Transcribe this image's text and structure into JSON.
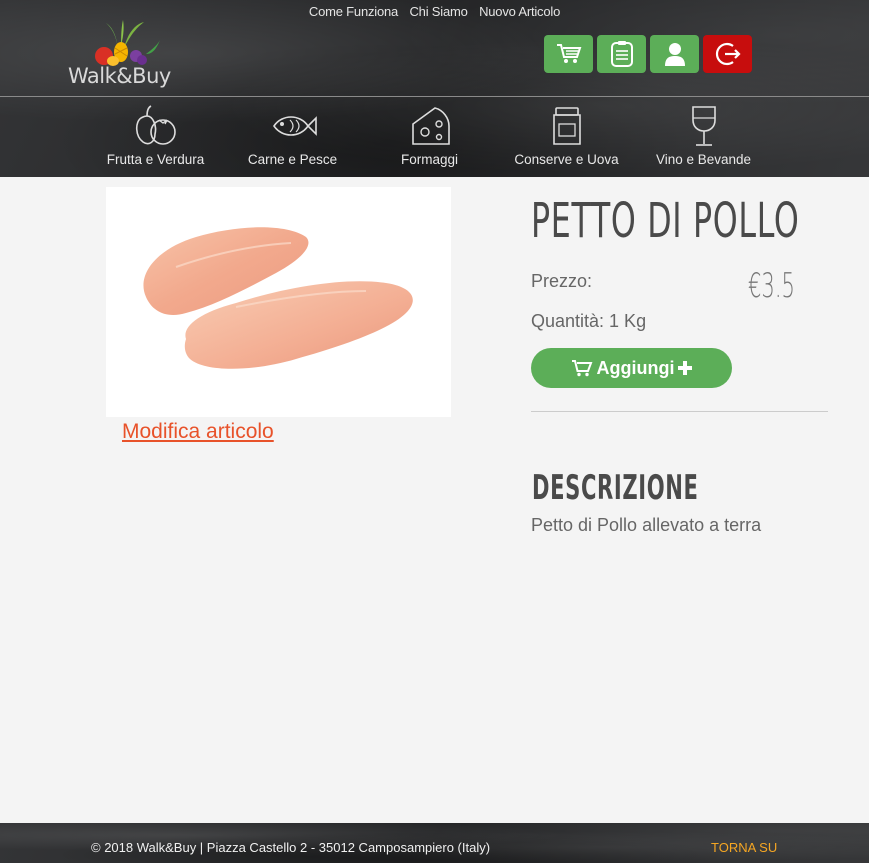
{
  "header": {
    "top_links": [
      "Come Funziona",
      "Chi Siamo",
      "Nuovo Articolo"
    ],
    "logo_text": "Walk&Buy",
    "actions": [
      {
        "name": "cart-icon",
        "color": "#5cae58"
      },
      {
        "name": "clipboard-icon",
        "color": "#5cae58"
      },
      {
        "name": "user-icon",
        "color": "#5cae58"
      },
      {
        "name": "logout-icon",
        "color": "#c70d0d"
      }
    ],
    "categories": [
      {
        "label": "Frutta e Verdura",
        "icon": "vegetables-icon"
      },
      {
        "label": "Carne e Pesce",
        "icon": "fish-icon"
      },
      {
        "label": "Formaggi",
        "icon": "cheese-icon"
      },
      {
        "label": "Conserve e Uova",
        "icon": "jar-icon"
      },
      {
        "label": "Vino e Bevande",
        "icon": "wine-glass-icon"
      }
    ]
  },
  "product": {
    "title": "PETTO DI POLLO",
    "price_label": "Prezzo:",
    "price_value": "€3.5",
    "quantity_label": "Quantità: 1 Kg",
    "add_button_label": "Aggiungi",
    "edit_link": "Modifica articolo",
    "description_title": "DESCRIZIONE",
    "description_text": "Petto di Pollo allevato a terra"
  },
  "footer": {
    "copyright": "© 2018 Walk&Buy | Piazza Castello 2 - 35012 Camposampiero (Italy)",
    "back_to_top": "TORNA SU"
  },
  "colors": {
    "accent_green": "#5cae58",
    "danger_red": "#c70d0d",
    "link_orange": "#e8522a",
    "footer_link": "#f5a623"
  }
}
